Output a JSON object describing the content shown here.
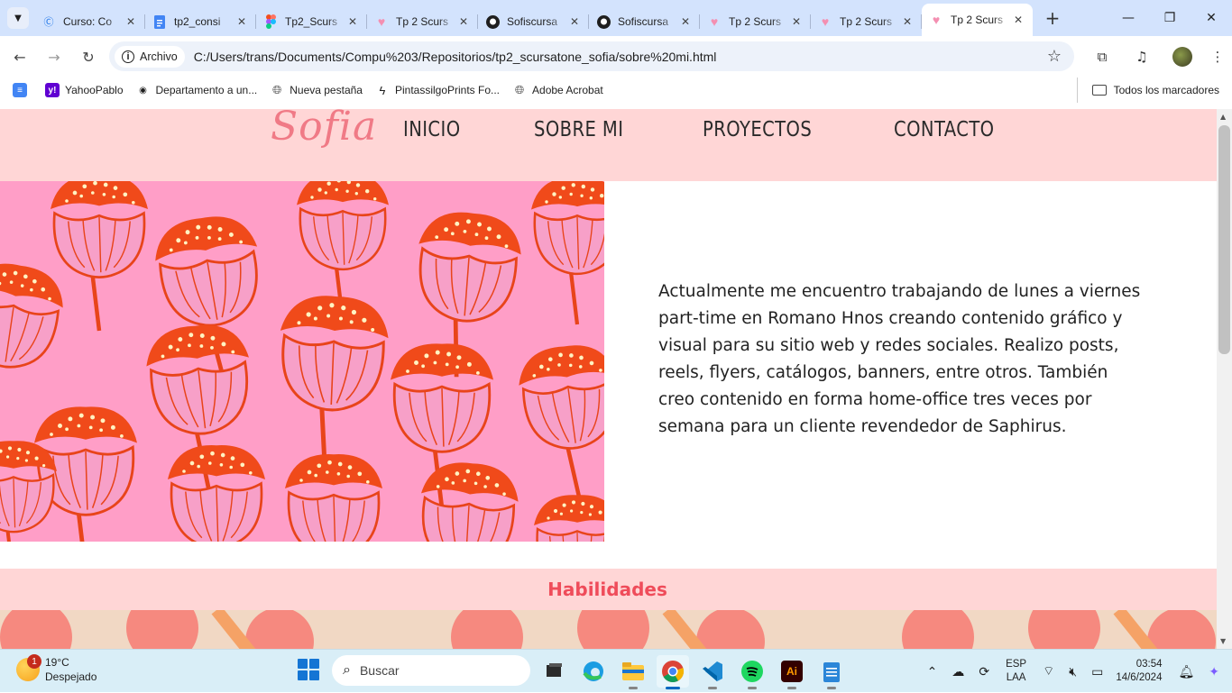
{
  "browser": {
    "tabs": [
      {
        "title": "Curso: Co",
        "favicon": "course-icon",
        "favicon_color": "#1a73e8"
      },
      {
        "title": "tp2_consi",
        "favicon": "docs-icon",
        "favicon_color": "#4285f4"
      },
      {
        "title": "Tp2_Scurs",
        "favicon": "figma-icon",
        "favicon_color": "#f24e1e"
      },
      {
        "title": "Tp 2 Scurs",
        "favicon": "heart-icon",
        "favicon_color": "#f48fb1"
      },
      {
        "title": "Sofiscursa",
        "favicon": "github-icon",
        "favicon_color": "#1f1f1f"
      },
      {
        "title": "Sofiscursa",
        "favicon": "github-icon",
        "favicon_color": "#1f1f1f"
      },
      {
        "title": "Tp 2 Scurs",
        "favicon": "heart-icon",
        "favicon_color": "#f48fb1"
      },
      {
        "title": "Tp 2 Scurs",
        "favicon": "heart-icon",
        "favicon_color": "#f48fb1"
      },
      {
        "title": "Tp 2 Scurs",
        "favicon": "heart-icon",
        "favicon_color": "#f48fb1",
        "active": true
      }
    ],
    "address_chip": "Archivo",
    "url": "C:/Users/trans/Documents/Compu%203/Repositorios/tp2_scursatone_sofia/sobre%20mi.html",
    "bookmarks": [
      {
        "label": "",
        "icon": "docs-icon"
      },
      {
        "label": "YahooPablo",
        "icon": "yahoo-icon"
      },
      {
        "label": "Departamento a un...",
        "icon": "eye-icon"
      },
      {
        "label": "Nueva pestaña",
        "icon": "globe-icon"
      },
      {
        "label": "PintassilgoPrints Fo...",
        "icon": "bolt-icon"
      },
      {
        "label": "Adobe Acrobat",
        "icon": "globe-icon"
      }
    ],
    "all_bookmarks": "Todos los marcadores"
  },
  "page": {
    "logo": "Sofia",
    "nav": [
      "INICIO",
      "SOBRE MI",
      "PROYECTOS",
      "CONTACTO"
    ],
    "about": "Actualmente me encuentro trabajando de lunes a viernes part-time en Romano Hnos creando contenido gráfico y visual para su sitio web y redes sociales. Realizo posts, reels, flyers, catálogos, banners, entre otros. También creo contenido en forma home-office tres veces por semana para un cliente revendedor de Saphirus.",
    "skills_title": "Habilidades",
    "colors": {
      "header_bg": "#ffd6d6",
      "accent": "#ef4c5a",
      "flower_bg": "#ff9ec7",
      "flower": "#f04a1a"
    }
  },
  "taskbar": {
    "weather_temp": "19°C",
    "weather_desc": "Despejado",
    "weather_badge": "1",
    "search_placeholder": "Buscar",
    "lang_top": "ESP",
    "lang_bottom": "LAA",
    "time": "03:54",
    "date": "14/6/2024"
  }
}
